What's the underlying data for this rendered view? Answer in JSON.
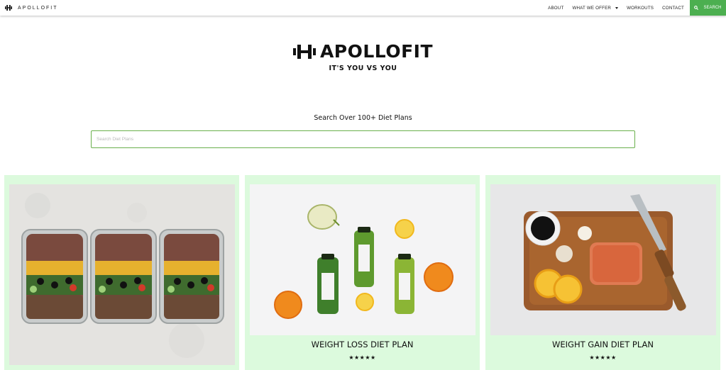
{
  "nav": {
    "brand": "APOLLOFIT",
    "links": [
      "ABOUT",
      "WHAT WE OFFER",
      "WORKOUTS",
      "CONTACT"
    ],
    "search_label": "SEARCH",
    "icons": {
      "logo": "dumbbell-icon",
      "search": "search-icon",
      "dropdown": "caret-down-icon"
    }
  },
  "hero": {
    "title": "APOLLOFIT",
    "tagline": "IT'S YOU VS YOU"
  },
  "search": {
    "label": "Search Over 100+ Diet Plans",
    "placeholder": "Search Diet Plans"
  },
  "cards": [
    {
      "image": "meal-prep-containers-photo",
      "title": "",
      "rating": ""
    },
    {
      "image": "green-juice-bottles-photo",
      "title": "WEIGHT LOSS DIET PLAN",
      "rating": "★★★★★"
    },
    {
      "image": "salmon-cutting-board-photo",
      "title": "WEIGHT GAIN DIET PLAN",
      "rating": "★★★★★"
    }
  ],
  "colors": {
    "accent": "#4caf50",
    "card_bg": "#dcfadd",
    "search_border": "#6ab04c"
  }
}
